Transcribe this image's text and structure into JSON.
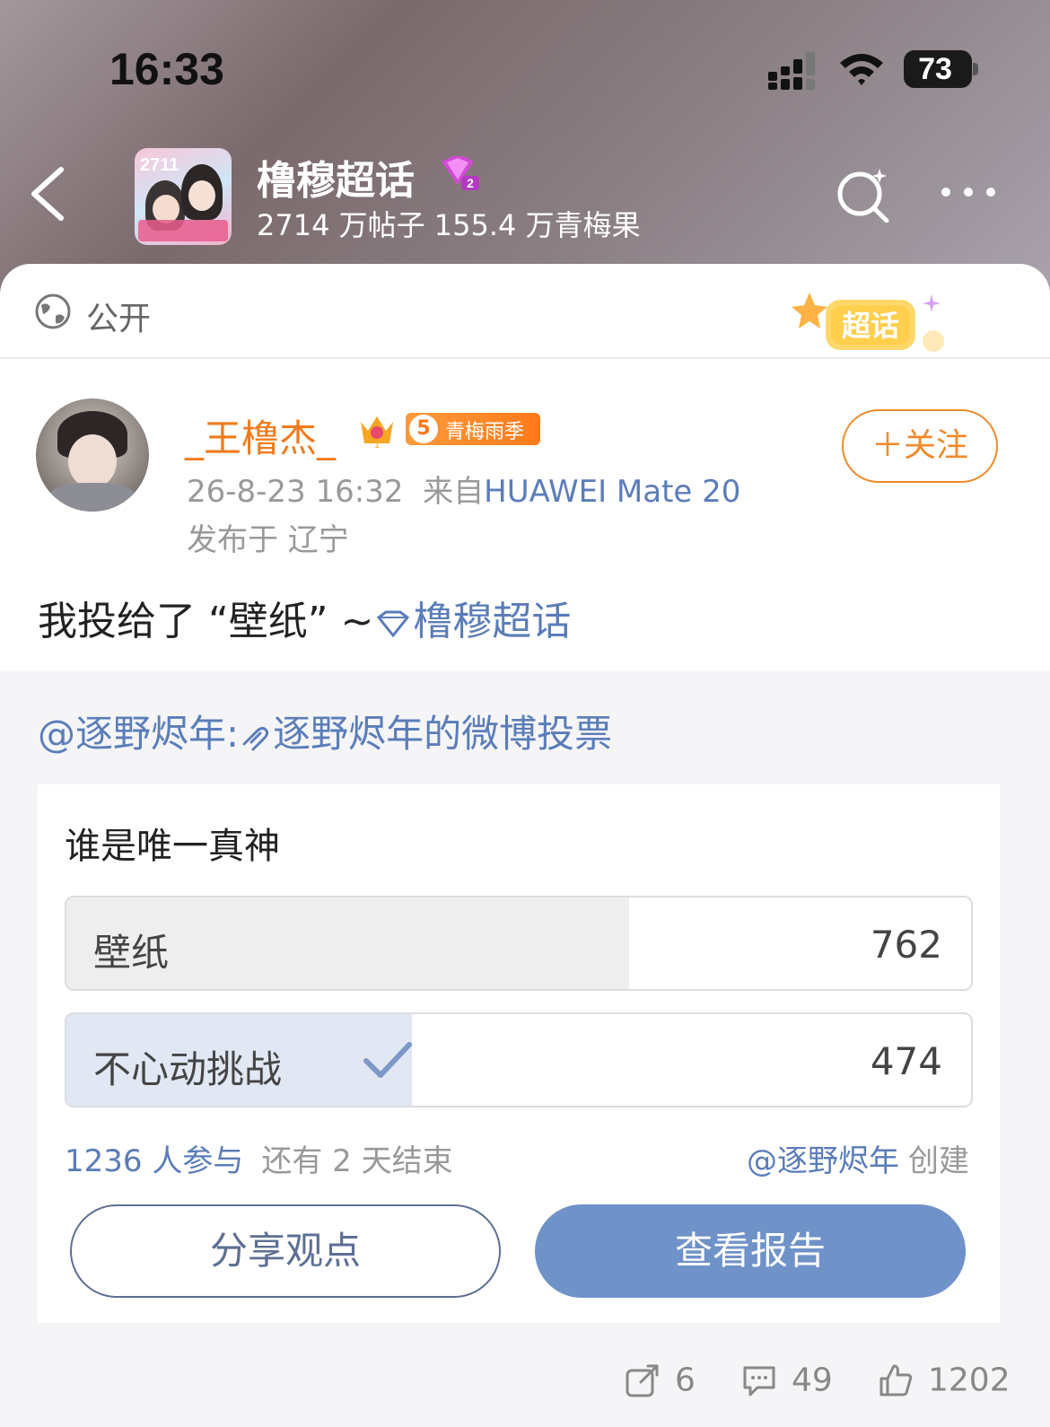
{
  "status_bar": {
    "time": "16:33",
    "battery": "73"
  },
  "header": {
    "topic_title": "橹穆超话",
    "topic_stats": "2714 万帖子 155.4 万青梅果",
    "thumb_text": "2711"
  },
  "visibility": {
    "label": "公开",
    "badge_text": "超话"
  },
  "post": {
    "username": "_王橹杰_",
    "crown_level": "1",
    "season_level": "5",
    "season_label": "青梅雨季",
    "follow_label": "＋关注",
    "timestamp": "26-8-23 16:32",
    "source_prefix": "来自",
    "device": "HUAWEI Mate 20",
    "location": "发布于 辽宁",
    "text_prefix": "我投给了 “壁纸” ~",
    "topic_link": "橹穆超话"
  },
  "repost": {
    "mention": "@逐野烬年:",
    "link_text": "逐野烬年的微博投票"
  },
  "poll": {
    "title": "谁是唯一真神",
    "options": [
      {
        "label": "壁纸",
        "count": "762",
        "share": 0.62,
        "selected": false
      },
      {
        "label": "不心动挑战",
        "count": "474",
        "share": 0.38,
        "selected": true
      }
    ],
    "participants": "1236 人参与",
    "remaining": "还有 2 天结束",
    "creator": "@逐野烬年",
    "creator_suffix": "创建",
    "share_label": "分享观点",
    "report_label": "查看报告"
  },
  "actions": {
    "reposts": "6",
    "comments": "49",
    "likes": "1202"
  },
  "colors": {
    "accent_blue": "#5b7db9",
    "orange": "#f07b1d",
    "report_button": "#6f92c8",
    "selected_bar": "#e1e8f4",
    "unselected_bar": "#eeeeee"
  }
}
